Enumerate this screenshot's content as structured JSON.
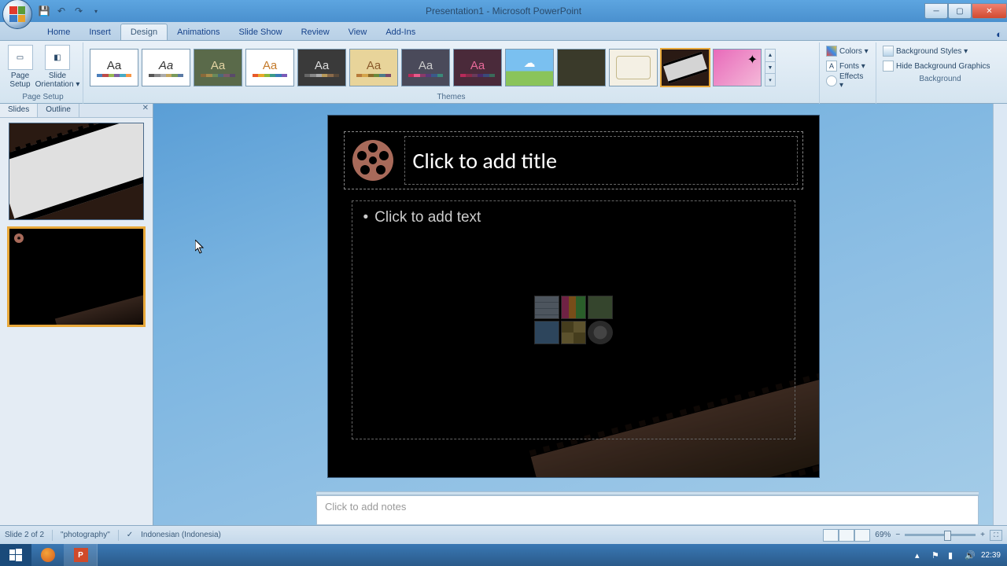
{
  "window": {
    "title": "Presentation1 - Microsoft PowerPoint",
    "qat": {
      "save": "save-icon",
      "undo": "undo-icon",
      "redo": "redo-icon"
    }
  },
  "tabs": {
    "items": [
      "Home",
      "Insert",
      "Design",
      "Animations",
      "Slide Show",
      "Review",
      "View",
      "Add-Ins"
    ],
    "active_index": 2
  },
  "ribbon": {
    "page_setup": {
      "label": "Page Setup",
      "page_setup_btn": "Page\nSetup",
      "orientation_btn": "Slide\nOrientation ▾"
    },
    "themes_label": "Themes",
    "background_label": "Background",
    "colors": "Colors ▾",
    "fonts": "Fonts ▾",
    "effects": "Effects ▾",
    "bg_styles": "Background Styles ▾",
    "hide_bg": "Hide Background Graphics"
  },
  "panel": {
    "tabs": [
      "Slides",
      "Outline"
    ],
    "active": 0
  },
  "canvas": {
    "title_placeholder": "Click to add title",
    "content_placeholder": "Click to add text"
  },
  "notes_placeholder": "Click to add notes",
  "status": {
    "slide": "Slide 2 of 2",
    "theme": "\"photography\"",
    "language": "Indonesian (Indonesia)",
    "zoom": "69%"
  },
  "tray": {
    "time": "22:39"
  }
}
